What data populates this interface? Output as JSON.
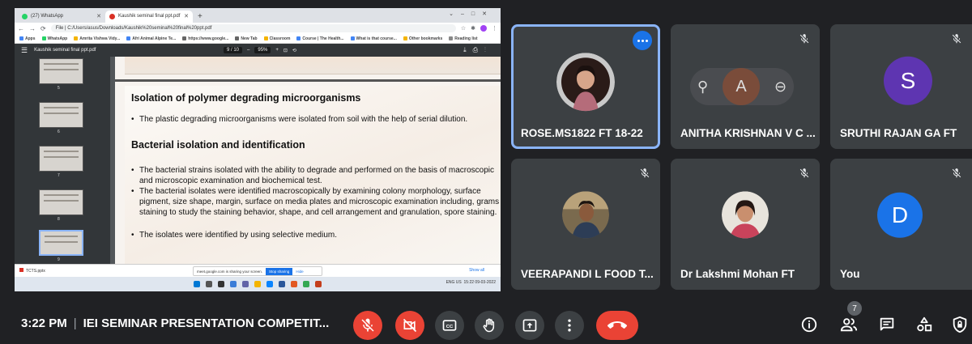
{
  "colors": {
    "background": "#202124",
    "tile": "#3c4043",
    "accent": "#8ab4f8",
    "danger": "#ea4335",
    "avatar_s": "#5e35b1",
    "avatar_d": "#1a73e8"
  },
  "browser": {
    "tabs": [
      {
        "label": "(27) WhatsApp",
        "active": false
      },
      {
        "label": "Kaushik seminal final ppt.pdf",
        "active": true
      }
    ],
    "address": "File | C:/Users/asus/Downloads/Kaushik%20seminal%20final%20ppt.pdf",
    "bookmarks": [
      "Apps",
      "WhatsApp",
      "Amrita Vishwa Vidy...",
      "Afri Animal Alpine Te...",
      "https://www.google...",
      "New Tab",
      "Classroom",
      "Course | The Health...",
      "What is that course...",
      "Other bookmarks",
      "Reading list"
    ],
    "pdf_title": "Kaushik seminal final ppt.pdf",
    "page_indicator": "9 / 10",
    "zoom": "95%",
    "thumb_numbers": [
      "5",
      "6",
      "7",
      "8",
      "9"
    ],
    "download_file": "TCTS.pptx",
    "share_banner": "meet.google.com is sharing your screen.",
    "stop_sharing": "Stop sharing",
    "hide": "Hide",
    "show_all": "Show all",
    "tray_lang": "ENG US",
    "tray_time": "15:22",
    "tray_date": "09-03-2022"
  },
  "slide": {
    "heading1": "Isolation of polymer degrading microorganisms",
    "bullet1": "The plastic degrading microorganisms were isolated from soil with the help of serial dilution.",
    "heading2": "Bacterial isolation and identification",
    "bullets": [
      "The bacterial strains isolated with the ability to degrade and performed on the basis of macroscopic and microscopic examination and biochemical test.",
      "The bacterial isolates were identified macroscopically by examining colony morphology, surface pigment, size shape, margin, surface on media plates and microscopic examination including, grams staining to study the staining behavior, shape, and cell arrangement and granulation, spore staining.",
      "The isolates were identified by using selective medium."
    ]
  },
  "participants": [
    {
      "name": "ROSE.MS1822 FT 18-22",
      "avatar": "photo",
      "muted": false,
      "speaking": true
    },
    {
      "name": "ANITHA KRISHNAN V C ...",
      "avatar": "letter-hover",
      "letter": "A",
      "muted": true
    },
    {
      "name": "SRUTHI RAJAN GA FT",
      "avatar": "letter",
      "letter": "S",
      "muted": true
    },
    {
      "name": "VEERAPANDI L FOOD T...",
      "avatar": "photo",
      "muted": true
    },
    {
      "name": "Dr Lakshmi Mohan FT",
      "avatar": "photo",
      "muted": true
    },
    {
      "name": "You",
      "avatar": "letter",
      "letter": "D",
      "muted": true
    }
  ],
  "meeting": {
    "time": "3:22 PM",
    "title": "IEI SEMINAR PRESENTATION COMPETIT...",
    "people_count": "7"
  },
  "icons": [
    "mic-off-icon",
    "camera-off-icon",
    "captions-icon",
    "raise-hand-icon",
    "present-icon",
    "more-options-icon",
    "end-call-icon",
    "info-icon",
    "people-icon",
    "chat-icon",
    "activities-icon",
    "host-controls-icon"
  ]
}
